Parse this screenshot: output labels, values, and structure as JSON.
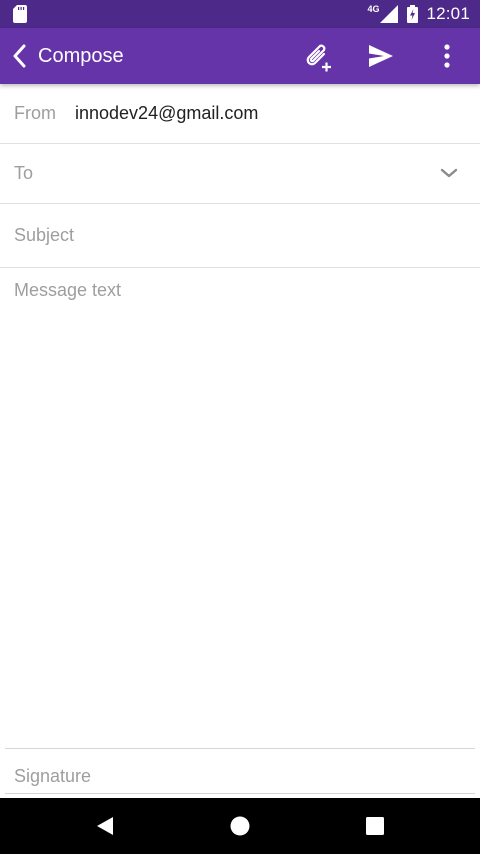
{
  "status_bar": {
    "network": "4G",
    "time": "12:01",
    "icons": [
      "sd-card-icon",
      "signal-icon",
      "battery-charging-icon"
    ]
  },
  "app_bar": {
    "title": "Compose",
    "color": "#6534a8",
    "status_color": "#4d2a8a",
    "icons": [
      "back-chevron-icon",
      "attach-add-icon",
      "send-icon",
      "more-vert-icon"
    ]
  },
  "form": {
    "from_label": "From",
    "from_value": "innodev24@gmail.com",
    "to_placeholder": "To",
    "subject_placeholder": "Subject",
    "message_placeholder": "Message text",
    "signature_placeholder": "Signature"
  },
  "nav_bar": {
    "icons": [
      "nav-back-icon",
      "nav-home-icon",
      "nav-recents-icon"
    ]
  }
}
